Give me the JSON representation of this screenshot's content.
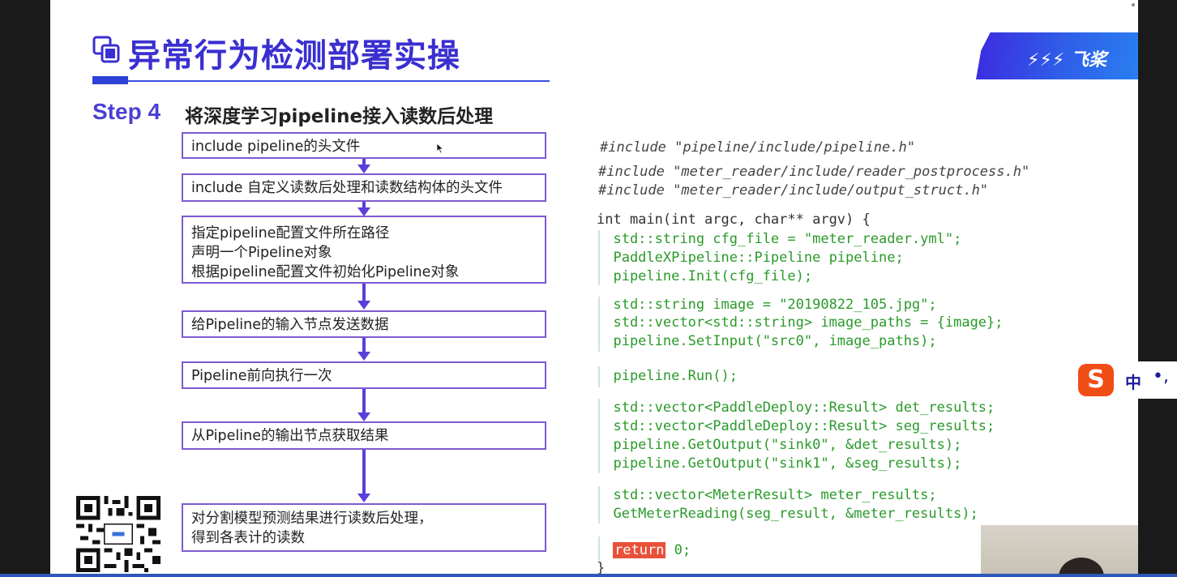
{
  "slide": {
    "title": "异常行为检测部署实操",
    "logo_text": "飞桨",
    "step": {
      "number": "Step 4",
      "description": "将深度学习pipeline接入读数后处理"
    }
  },
  "flow": [
    {
      "lines": [
        "include pipeline的头文件"
      ]
    },
    {
      "lines": [
        "include 自定义读数后处理和读数结构体的头文件"
      ]
    },
    {
      "lines": [
        "指定pipeline配置文件所在路径",
        "声明一个Pipeline对象",
        "根据pipeline配置文件初始化Pipeline对象"
      ]
    },
    {
      "lines": [
        "给Pipeline的输入节点发送数据"
      ]
    },
    {
      "lines": [
        "Pipeline前向执行一次"
      ]
    },
    {
      "lines": [
        "从Pipeline的输出节点获取结果"
      ]
    },
    {
      "lines": [
        "对分割模型预测结果进行读数后处理，",
        "得到各表计的读数"
      ]
    }
  ],
  "code": {
    "include1": "#include \"pipeline/include/pipeline.h\"",
    "include2": "#include \"meter_reader/include/reader_postprocess.h\"",
    "include3": "#include \"meter_reader/include/output_struct.h\"",
    "main_sig": "int main(int argc, char** argv) {",
    "l1": "  std::string cfg_file = \"meter_reader.yml\";",
    "l2": "  PaddleXPipeline::Pipeline pipeline;",
    "l3": "  pipeline.Init(cfg_file);",
    "l4": "  std::string image = \"20190822_105.jpg\";",
    "l5": "  std::vector<std::string> image_paths = {image};",
    "l6": "  pipeline.SetInput(\"src0\", image_paths);",
    "l7": "  pipeline.Run();",
    "l8": "  std::vector<PaddleDeploy::Result> det_results;",
    "l9": "  std::vector<PaddleDeploy::Result> seg_results;",
    "l10": "  pipeline.GetOutput(\"sink0\", &det_results);",
    "l11": "  pipeline.GetOutput(\"sink1\", &seg_results);",
    "l12": "  std::vector<MeterResult> meter_results;",
    "l13": "  GetMeterReading(seg_result, &meter_results);",
    "ret_kw": "return",
    "ret_val": " 0;",
    "close": "}"
  },
  "ime": {
    "logo": "S",
    "mode": "中",
    "punct": "•,"
  },
  "colors": {
    "accent": "#3a2fd0",
    "box_border": "#7d5ad0",
    "arrow": "#5b3fd8",
    "code_green": "#2a9a2a",
    "return_bg": "#e8503a"
  }
}
